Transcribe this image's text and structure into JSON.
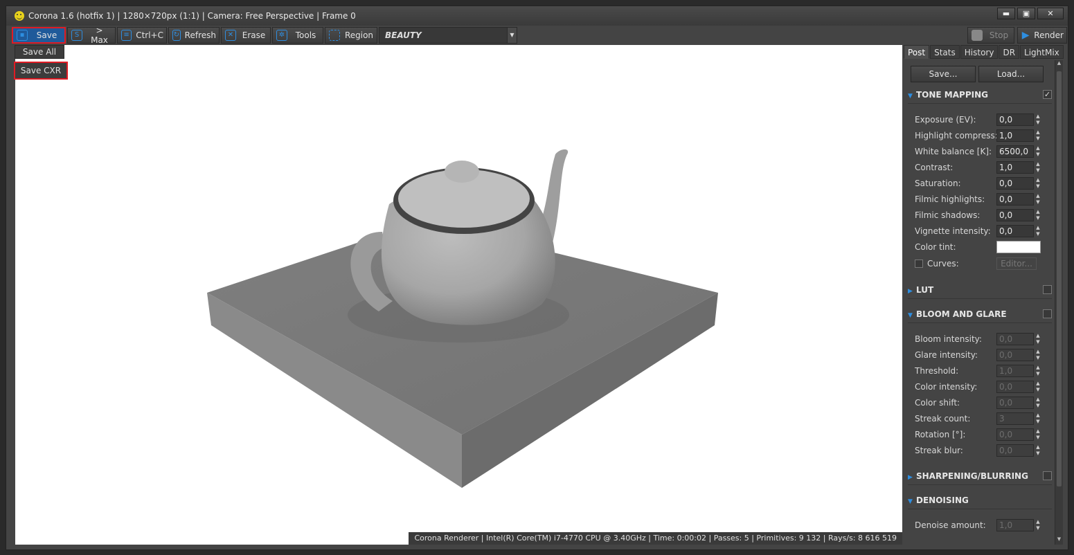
{
  "window": {
    "title": "Corona 1.6 (hotfix 1) | 1280×720px (1:1) | Camera: Free Perspective | Frame 0",
    "controls": {
      "minimize": "▬",
      "maximize": "▣",
      "close": "✕"
    }
  },
  "toolbar": {
    "save": "Save",
    "to_max": "> Max",
    "copy": "Ctrl+C",
    "refresh": "Refresh",
    "erase": "Erase",
    "tools": "Tools",
    "region": "Region",
    "channel": "BEAUTY",
    "stop": "Stop",
    "render": "Render"
  },
  "save_menu": {
    "items": [
      "Save All",
      "Save CXR"
    ]
  },
  "statusbar": "Corona Renderer | Intel(R) Core(TM) i7-4770 CPU @ 3.40GHz | Time: 0:00:02 | Passes: 5 | Primitives: 9 132 | Rays/s: 8 616 519",
  "panel": {
    "tabs": [
      "Post",
      "Stats",
      "History",
      "DR",
      "LightMix"
    ],
    "active_tab": "Post",
    "save_btn": "Save...",
    "load_btn": "Load...",
    "sections": {
      "tone_mapping": "TONE MAPPING",
      "lut": "LUT",
      "bloom": "BLOOM AND GLARE",
      "sharpen": "SHARPENING/BLURRING",
      "denoise": "DENOISING"
    },
    "tone": [
      {
        "label": "Exposure (EV):",
        "value": "0,0"
      },
      {
        "label": "Highlight compress:",
        "value": "1,0"
      },
      {
        "label": "White balance [K]:",
        "value": "6500,0"
      },
      {
        "label": "Contrast:",
        "value": "1,0"
      },
      {
        "label": "Saturation:",
        "value": "0,0"
      },
      {
        "label": "Filmic highlights:",
        "value": "0,0"
      },
      {
        "label": "Filmic shadows:",
        "value": "0,0"
      },
      {
        "label": "Vignette intensity:",
        "value": "0,0"
      }
    ],
    "color_tint": "Color tint:",
    "curves": "Curves:",
    "editor": "Editor...",
    "bloom_rows": [
      {
        "label": "Bloom intensity:",
        "value": "0,0"
      },
      {
        "label": "Glare intensity:",
        "value": "0,0"
      },
      {
        "label": "Threshold:",
        "value": "1,0"
      },
      {
        "label": "Color intensity:",
        "value": "0,0"
      },
      {
        "label": "Color shift:",
        "value": "0,0"
      },
      {
        "label": "Streak count:",
        "value": "3"
      },
      {
        "label": "Rotation [°]:",
        "value": "0,0"
      },
      {
        "label": "Streak blur:",
        "value": "0,0"
      }
    ],
    "denoise_row": {
      "label": "Denoise amount:",
      "value": "1,0"
    }
  },
  "colors": {
    "accent": "#2e8ee0",
    "highlight": "#e01b24"
  }
}
